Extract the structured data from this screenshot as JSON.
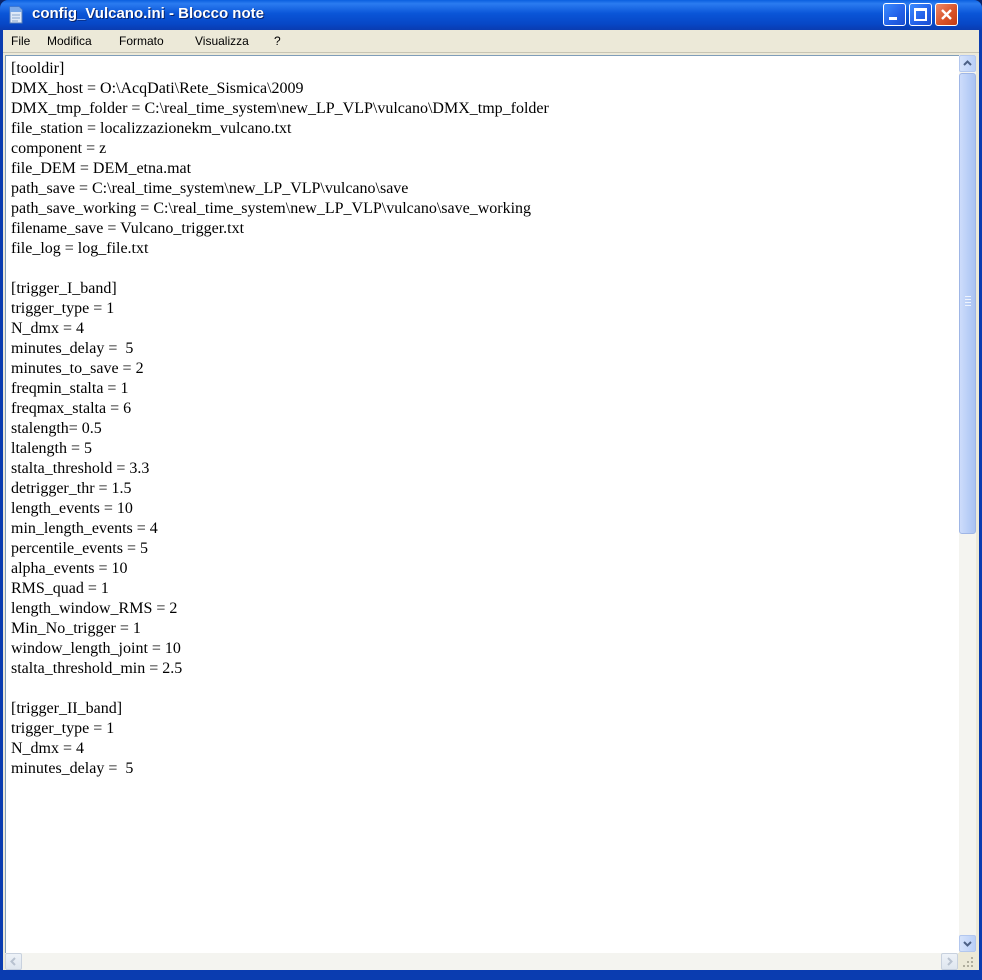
{
  "window": {
    "title": "config_Vulcano.ini - Blocco note",
    "icon": "notepad-icon"
  },
  "menu": {
    "items": [
      {
        "label": "File",
        "mnemonic": "F"
      },
      {
        "label": "Modifica",
        "mnemonic": "M"
      },
      {
        "label": "Formato",
        "mnemonic": "o"
      },
      {
        "label": "Visualizza",
        "mnemonic": "V"
      },
      {
        "label": "?",
        "mnemonic": "?"
      }
    ]
  },
  "document": {
    "lines": [
      "[tooldir]",
      "DMX_host = O:\\AcqDati\\Rete_Sismica\\2009",
      "DMX_tmp_folder = C:\\real_time_system\\new_LP_VLP\\vulcano\\DMX_tmp_folder",
      "file_station = localizzazionekm_vulcano.txt",
      "component = z",
      "file_DEM = DEM_etna.mat",
      "path_save = C:\\real_time_system\\new_LP_VLP\\vulcano\\save",
      "path_save_working = C:\\real_time_system\\new_LP_VLP\\vulcano\\save_working",
      "filename_save = Vulcano_trigger.txt",
      "file_log = log_file.txt",
      "",
      "[trigger_I_band]",
      "trigger_type = 1",
      "N_dmx = 4",
      "minutes_delay =  5",
      "minutes_to_save = 2",
      "freqmin_stalta = 1",
      "freqmax_stalta = 6",
      "stalength= 0.5",
      "ltalength = 5",
      "stalta_threshold = 3.3",
      "detrigger_thr = 1.5",
      "length_events = 10",
      "min_length_events = 4",
      "percentile_events = 5",
      "alpha_events = 10",
      "RMS_quad = 1",
      "length_window_RMS = 2",
      "Min_No_trigger = 1",
      "window_length_joint = 10",
      "stalta_threshold_min = 2.5",
      "",
      "[trigger_II_band]",
      "trigger_type = 1",
      "N_dmx = 4",
      "minutes_delay =  5"
    ]
  },
  "colors": {
    "title_bar": "#0a55d8",
    "frame": "#0a3cb0",
    "menu_bg": "#ece9d8",
    "close_button": "#d9542a"
  }
}
